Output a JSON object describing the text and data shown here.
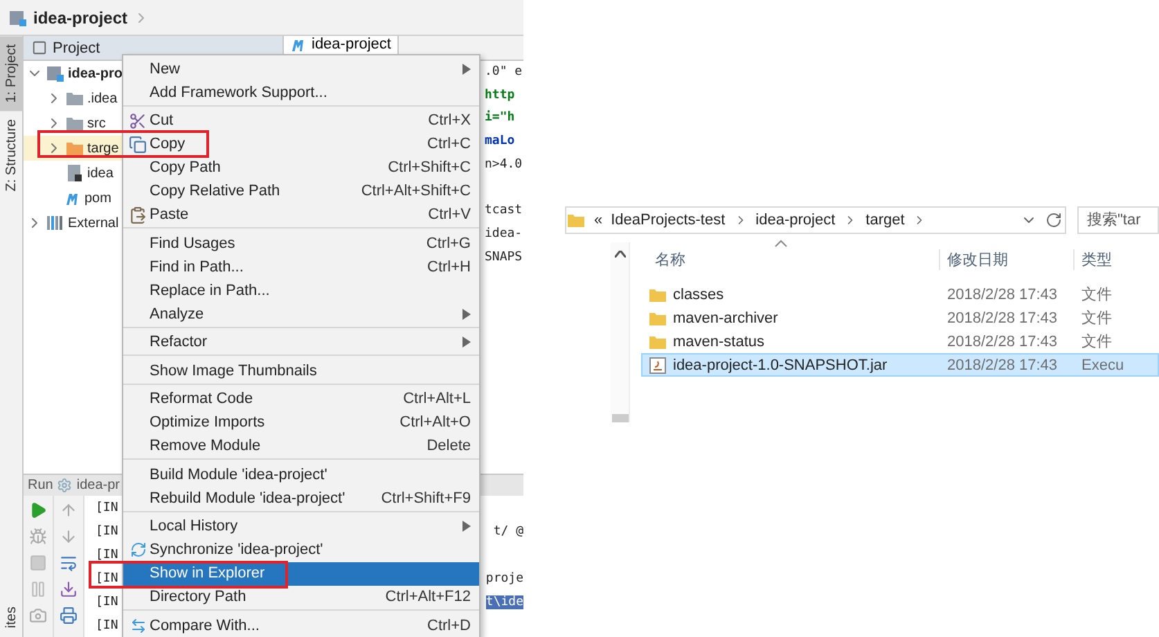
{
  "ide": {
    "breadcrumb": "idea-project",
    "tool_tabs": [
      {
        "label": "1: Project",
        "selected": true
      },
      {
        "label": "Z: Structure",
        "selected": false
      }
    ],
    "tool_tab_bottom": "ites",
    "project_panel": {
      "title": "Project",
      "tree": [
        {
          "label": "idea-pro",
          "kind": "module",
          "expanded": true,
          "selected": false,
          "children": [
            {
              "label": ".idea",
              "kind": "folder",
              "expanded": false,
              "selected": false
            },
            {
              "label": "src",
              "kind": "folder",
              "expanded": false,
              "selected": false
            },
            {
              "label": "targe",
              "kind": "excluded-folder",
              "expanded": false,
              "selected": true
            },
            {
              "label": "idea",
              "kind": "module-file",
              "selected": false
            },
            {
              "label": "pom",
              "kind": "maven-file",
              "selected": false
            }
          ]
        },
        {
          "label": "External",
          "kind": "libraries",
          "expanded": false,
          "selected": false
        }
      ]
    },
    "editor_tab": "idea-project",
    "code_lines": [
      {
        "text": ".0\" e",
        "kind": "plain"
      },
      {
        "text": "http",
        "kind": "string"
      },
      {
        "text": "i=\"h",
        "kind": "string"
      },
      {
        "text": "maLo",
        "kind": "tag"
      },
      {
        "text": "n>4.0",
        "kind": "plain"
      },
      {
        "kind": "blank"
      },
      {
        "text": "tcast",
        "kind": "plain"
      },
      {
        "text": "idea-",
        "kind": "plain"
      },
      {
        "text": "SNAPS",
        "kind": "plain"
      }
    ],
    "run_panel": {
      "title": "Run",
      "config": "idea-pr",
      "console": [
        {
          "start": "[IN"
        },
        {
          "start": "[IN",
          "end": "t/ @"
        },
        {
          "start": "[IN"
        },
        {
          "start": "[IN",
          "end": "proje"
        },
        {
          "start": "[IN",
          "end": "t\\ide",
          "highlighted": true
        },
        {
          "start": "[IN"
        }
      ]
    },
    "context_menu": [
      [
        {
          "label": "New",
          "submenu": true,
          "selected": false
        },
        {
          "label": "Add Framework Support...",
          "selected": false
        }
      ],
      [
        {
          "label": "Cut",
          "kind": "cut",
          "shortcut": "Ctrl+X",
          "selected": false
        },
        {
          "label": "Copy",
          "kind": "copy",
          "shortcut": "Ctrl+C",
          "selected": false
        },
        {
          "label": "Copy Path",
          "shortcut": "Ctrl+Shift+C",
          "selected": false
        },
        {
          "label": "Copy Relative Path",
          "shortcut": "Ctrl+Alt+Shift+C",
          "selected": false
        },
        {
          "label": "Paste",
          "kind": "paste",
          "shortcut": "Ctrl+V",
          "selected": false
        }
      ],
      [
        {
          "label": "Find Usages",
          "shortcut": "Ctrl+G",
          "selected": false
        },
        {
          "label": "Find in Path...",
          "shortcut": "Ctrl+H",
          "selected": false
        },
        {
          "label": "Replace in Path...",
          "selected": false
        },
        {
          "label": "Analyze",
          "submenu": true,
          "selected": false
        }
      ],
      [
        {
          "label": "Refactor",
          "submenu": true,
          "selected": false
        }
      ],
      [
        {
          "label": "Show Image Thumbnails",
          "selected": false
        }
      ],
      [
        {
          "label": "Reformat Code",
          "shortcut": "Ctrl+Alt+L",
          "selected": false
        },
        {
          "label": "Optimize Imports",
          "shortcut": "Ctrl+Alt+O",
          "selected": false
        },
        {
          "label": "Remove Module",
          "shortcut": "Delete",
          "selected": false
        }
      ],
      [
        {
          "label": "Build Module 'idea-project'",
          "selected": false
        },
        {
          "label": "Rebuild Module 'idea-project'",
          "shortcut": "Ctrl+Shift+F9",
          "selected": false
        }
      ],
      [
        {
          "label": "Local History",
          "submenu": true,
          "selected": false
        },
        {
          "label": "Synchronize 'idea-project'",
          "kind": "sync",
          "selected": false
        },
        {
          "label": "Show in Explorer",
          "selected": true
        },
        {
          "label": "Directory Path",
          "shortcut": "Ctrl+Alt+F12",
          "selected": false
        }
      ],
      [
        {
          "label": "Compare With...",
          "kind": "compare",
          "shortcut": "Ctrl+D",
          "selected": false
        }
      ]
    ]
  },
  "explorer": {
    "path_prefix": "«",
    "path": [
      "IdeaProjects-test",
      "idea-project",
      "target"
    ],
    "search": {
      "placeholder": "搜索\"tar"
    },
    "columns": [
      "名称",
      "修改日期",
      "类型"
    ],
    "rows": [
      {
        "name": "classes",
        "kind": "folder",
        "date": "2018/2/28 17:43",
        "type": "文件",
        "selected": false
      },
      {
        "name": "maven-archiver",
        "kind": "folder",
        "date": "2018/2/28 17:43",
        "type": "文件",
        "selected": false
      },
      {
        "name": "maven-status",
        "kind": "folder",
        "date": "2018/2/28 17:43",
        "type": "文件",
        "selected": false
      },
      {
        "name": "idea-project-1.0-SNAPSHOT.jar",
        "kind": "jar",
        "date": "2018/2/28 17:43",
        "type": "Execu",
        "selected": true
      }
    ]
  }
}
